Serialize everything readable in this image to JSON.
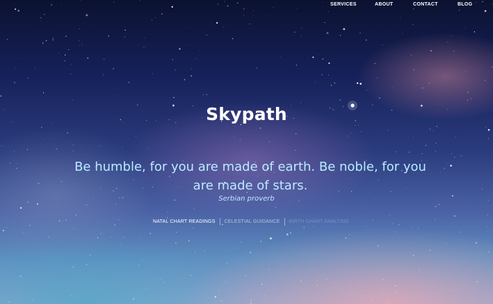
{
  "nav": {
    "items": [
      {
        "label": "SERVICES"
      },
      {
        "label": "ABOUT"
      },
      {
        "label": "CONTACT"
      },
      {
        "label": "BLOG"
      }
    ]
  },
  "hero": {
    "title": "Skypath",
    "quote": "Be humble, for you are made of earth. Be noble, for you are made of stars.",
    "attribution": "Serbian proverb"
  },
  "services": {
    "items": [
      {
        "label": "NATAL CHART READINGS"
      },
      {
        "label": "CELESTIAL GUIDANCE"
      },
      {
        "label": "BIRTH CHART ANALYSIS"
      }
    ]
  },
  "colors": {
    "quote_text": "#b9ecff",
    "title_text": "#ffffff",
    "sky_top": "#0b1230",
    "sky_bottom": "#8aa4cc"
  }
}
